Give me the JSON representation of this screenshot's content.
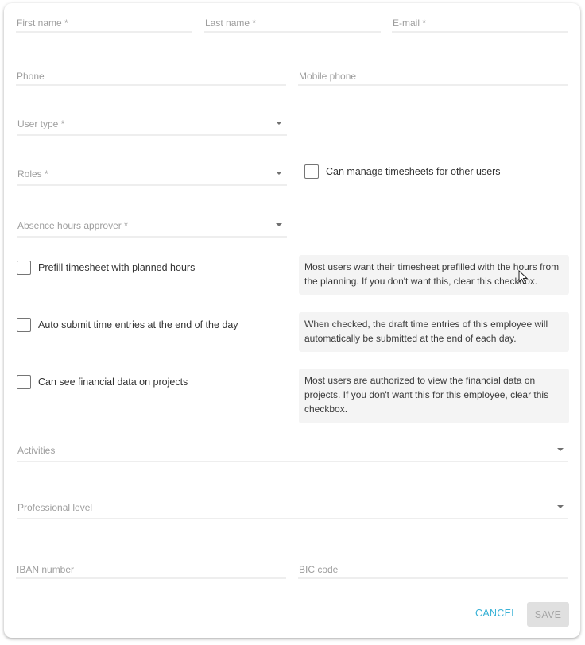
{
  "form": {
    "first_name": {
      "label": "First name *",
      "value": ""
    },
    "last_name": {
      "label": "Last name *",
      "value": ""
    },
    "email": {
      "label": "E-mail *",
      "value": ""
    },
    "phone": {
      "label": "Phone",
      "value": ""
    },
    "mobile_phone": {
      "label": "Mobile phone",
      "value": ""
    },
    "user_type": {
      "label": "User type *",
      "value": ""
    },
    "roles": {
      "label": "Roles *",
      "value": ""
    },
    "absence_approver": {
      "label": "Absence hours approver *",
      "value": ""
    },
    "activities": {
      "label": "Activities",
      "value": ""
    },
    "professional_level": {
      "label": "Professional level",
      "value": ""
    },
    "iban": {
      "label": "IBAN number",
      "value": ""
    },
    "bic": {
      "label": "BIC code",
      "value": ""
    }
  },
  "checkboxes": {
    "manage_timesheets": {
      "label": "Can manage timesheets for other users",
      "checked": false
    },
    "prefill_timesheet": {
      "label": "Prefill timesheet with planned hours",
      "checked": false
    },
    "auto_submit": {
      "label": "Auto submit time entries at the end of the day",
      "checked": false
    },
    "financial_data": {
      "label": "Can see financial data on projects",
      "checked": false
    }
  },
  "hints": {
    "prefill": "Most users want their timesheet prefilled with the hours from the planning. If you don't want this, clear this checkbox.",
    "auto_submit": "When checked, the draft time entries of this employee will automatically be submitted at the end of each day.",
    "financial": "Most users are authorized to view the financial data on projects. If you don't want this for this employee, clear this checkbox."
  },
  "actions": {
    "cancel_label": "CANCEL",
    "save_label": "SAVE"
  },
  "colors": {
    "accent": "#3ab2d6",
    "disabled_bg": "#e0e0e0"
  }
}
